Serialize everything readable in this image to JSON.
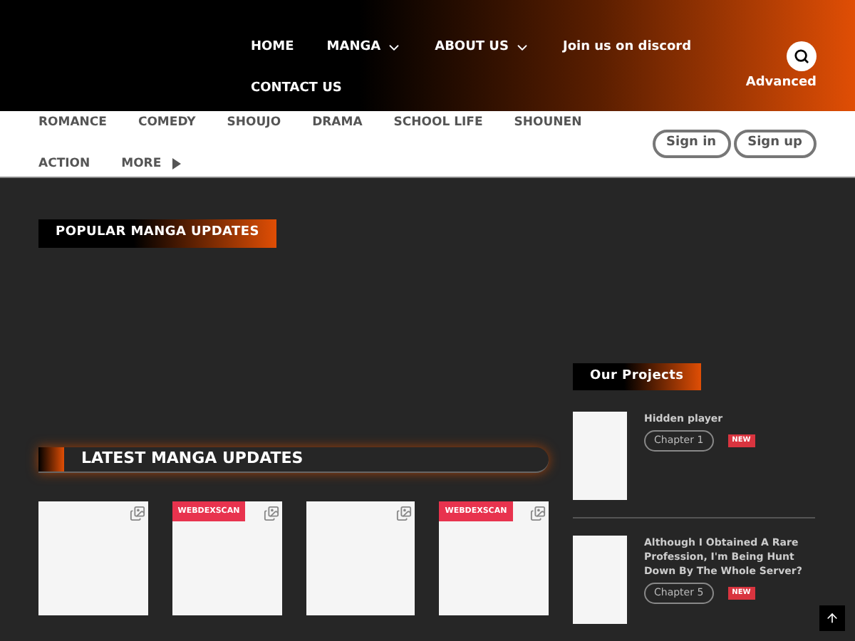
{
  "nav": [
    {
      "label": "HOME",
      "dropdown": false
    },
    {
      "label": "MANGA",
      "dropdown": true
    },
    {
      "label": "ABOUT US",
      "dropdown": true
    },
    {
      "label": "Join us on discord",
      "dropdown": false
    },
    {
      "label": "CONTACT US",
      "dropdown": false
    }
  ],
  "search": {
    "advanced": "Advanced"
  },
  "genres": [
    {
      "label": "ROMANCE",
      "more": false
    },
    {
      "label": "COMEDY",
      "more": false
    },
    {
      "label": "SHOUJO",
      "more": false
    },
    {
      "label": "DRAMA",
      "more": false
    },
    {
      "label": "SCHOOL LIFE",
      "more": false
    },
    {
      "label": "SHOUNEN",
      "more": false
    },
    {
      "label": "ACTION",
      "more": false
    },
    {
      "label": "MORE",
      "more": true
    }
  ],
  "auth": [
    "Sign in",
    "Sign up"
  ],
  "popular": {
    "title": "POPULAR MANGA UPDATES"
  },
  "latest": {
    "title": "LATEST MANGA UPDATES",
    "cards": [
      {
        "kind": "plain"
      },
      {
        "kind": "badged",
        "badge": "WEBDEXSCAN"
      },
      {
        "kind": "plain"
      },
      {
        "kind": "badged",
        "badge": "WEBDEXSCAN"
      }
    ]
  },
  "projects": {
    "title": "Our Projects",
    "items": [
      {
        "title": "Hidden player",
        "chapter": "Chapter 1",
        "badge": "NEW"
      },
      {
        "title": "Although I Obtained A Rare Profession, I'm Being Hunt Down By The Whole Server?",
        "chapter": "Chapter 5",
        "badge": "NEW"
      }
    ]
  }
}
